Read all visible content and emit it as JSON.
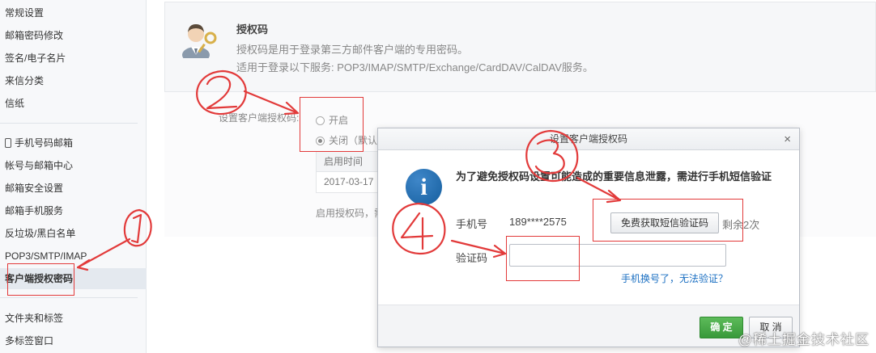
{
  "sidebar": {
    "items": [
      {
        "label": "常规设置"
      },
      {
        "label": "邮箱密码修改"
      },
      {
        "label": "签名/电子名片"
      },
      {
        "label": "来信分类"
      },
      {
        "label": "信纸"
      },
      {
        "label": "手机号码邮箱"
      },
      {
        "label": "帐号与邮箱中心"
      },
      {
        "label": "邮箱安全设置"
      },
      {
        "label": "邮箱手机服务"
      },
      {
        "label": "反垃圾/黑白名单"
      },
      {
        "label": "POP3/SMTP/IMAP"
      },
      {
        "label": "客户端授权密码"
      },
      {
        "label": "文件夹和标签"
      },
      {
        "label": "多标签窗口"
      }
    ]
  },
  "auth_panel": {
    "title": "授权码",
    "description": "授权码是用于登录第三方邮件客户端的专用密码。",
    "services": "适用于登录以下服务: POP3/IMAP/SMTP/Exchange/CardDAV/CalDAV服务。",
    "setting_label": "设置客户端授权码:",
    "option_on": "开启",
    "option_off": "关闭（默认",
    "table_header": "启用时间",
    "table_value": "2017-03-17",
    "enable_note": "启用授权码，需"
  },
  "modal": {
    "title": "设置客户端授权码",
    "close": "×",
    "message": "为了避免授权码设置可能造成的重要信息泄露，需进行手机短信验证",
    "phone_label": "手机号",
    "phone_value": "189****2575",
    "sms_button": "免费获取短信验证码",
    "remaining": "剩余2次",
    "code_label": "验证码",
    "code_value": "",
    "help_link": "手机换号了，无法验证？",
    "ok": "确 定",
    "cancel": "取 消"
  },
  "watermark": "@稀土掘金技术社区",
  "colors": {
    "annotation": "#e23a3a",
    "ok_button": "#3fa23f",
    "link": "#1a6fc2"
  }
}
